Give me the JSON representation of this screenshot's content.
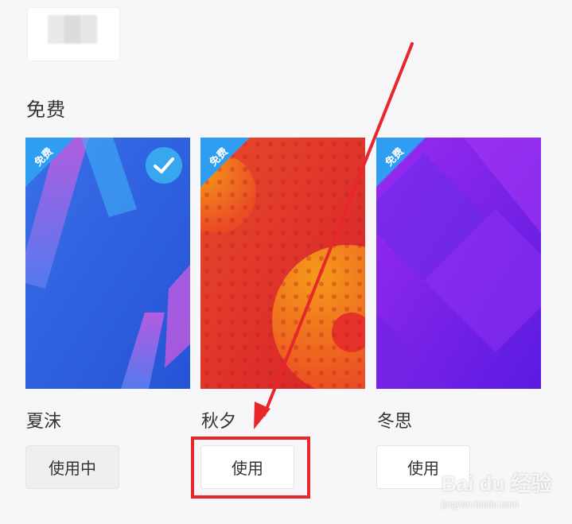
{
  "section": {
    "title": "免费"
  },
  "themes": [
    {
      "name": "夏沫",
      "badge": "免费",
      "button_label": "使用中",
      "selected": true,
      "color": "#2f61e0",
      "icon": "check-icon"
    },
    {
      "name": "秋夕",
      "badge": "免费",
      "button_label": "使用",
      "selected": false,
      "color": "#e03a2f"
    },
    {
      "name": "冬思",
      "badge": "免费",
      "button_label": "使用",
      "selected": false,
      "color": "#7b22f0"
    }
  ],
  "annotation": {
    "color": "#e8272c",
    "target": "theme-2-use-button"
  },
  "watermark": {
    "brand": "Bai du 经验",
    "url": "jingyan.baidu.com"
  }
}
